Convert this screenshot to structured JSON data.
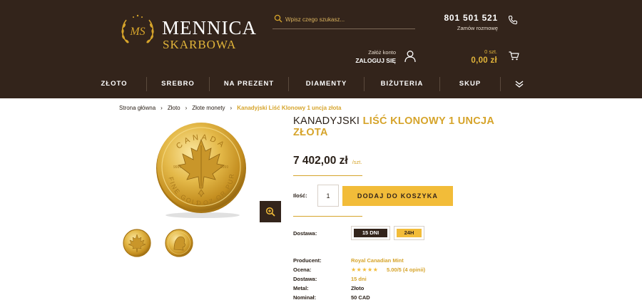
{
  "header": {
    "logo": {
      "line1": "MENNICA",
      "line2": "SKARBOWA",
      "emblem_monogram": "MS"
    },
    "search": {
      "placeholder": "Wpisz czego szukasz..."
    },
    "phone": {
      "number": "801 501 521",
      "sub": "Zamów rozmowę"
    },
    "account": {
      "top": "Załóż konto",
      "main": "ZALOGUJ SIĘ"
    },
    "cart": {
      "count": "0 szt.",
      "total": "0,00 zł"
    },
    "nav": [
      {
        "label": "ZŁOTO"
      },
      {
        "label": "SREBRO"
      },
      {
        "label": "NA PREZENT"
      },
      {
        "label": "DIAMENTY"
      },
      {
        "label": "BIŻUTERIA"
      },
      {
        "label": "SKUP"
      }
    ],
    "icons": {
      "search": "search-icon",
      "phone": "phone-icon",
      "user": "user-icon",
      "cart": "cart-icon",
      "more": "double-chevron-down-icon"
    }
  },
  "breadcrumb": [
    {
      "label": "Strona główna"
    },
    {
      "label": "Złoto"
    },
    {
      "label": "Złote monety"
    },
    {
      "label": "Kanadyjski Liść Klonowy 1 uncja złota"
    }
  ],
  "product": {
    "title_plain": "KANADYJSKI ",
    "title_accent": "LIŚĆ KLONOWY 1 UNCJA ZŁOTA",
    "price": "7 402,00 zł",
    "price_unit": "/szt.",
    "quantity_label": "Ilość:",
    "quantity_value": "1",
    "add_to_cart": "DODAJ DO KOSZYKA",
    "delivery_label": "Dostawa:",
    "delivery_options": [
      {
        "label": "15 DNI",
        "selected": true
      },
      {
        "label": "24H",
        "selected": false
      }
    ],
    "coin": {
      "top_text": "CANADA",
      "left_text": "FINE GOLD",
      "right_text": "1 OZ OR PUR",
      "purity": "9999"
    },
    "specs": [
      {
        "key": "Producent:",
        "value": "Royal Canadian Mint",
        "style": "gold"
      },
      {
        "key": "Ocena:",
        "stars": "★★★★★",
        "rating": 5.0,
        "rating_text": "5.00/5 (4 opinii)"
      },
      {
        "key": "Dostawa:",
        "value": "15 dni",
        "style": "gold"
      },
      {
        "key": "Metal:",
        "value": "Złoto",
        "style": "dark"
      },
      {
        "key": "Nominał:",
        "value": "50 CAD",
        "style": "dark"
      }
    ]
  },
  "colors": {
    "header_bg": "#33241b",
    "gold": "#d6a42b",
    "button": "#f2bc39",
    "text": "#2a2018"
  }
}
